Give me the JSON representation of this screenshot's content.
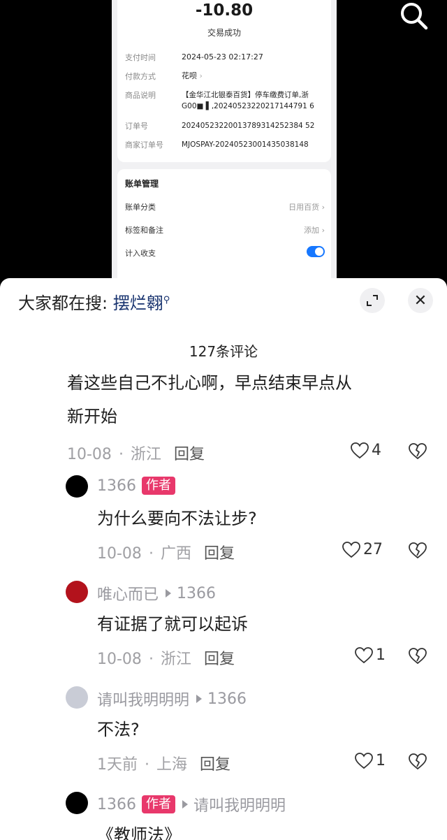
{
  "receipt": {
    "amount": "-10.80",
    "status": "交易成功",
    "rows": [
      {
        "key": "支付时间",
        "value": "2024-05-23 02:17:27"
      },
      {
        "key": "付款方式",
        "value": "花呗"
      },
      {
        "key": "商品说明",
        "value": "【金华江北银泰百货】停车缴费订单,浙G00■ ▌,20240523220217144791 6"
      },
      {
        "key": "订单号",
        "value": "20240523220013789314252384 52"
      },
      {
        "key": "商家订单号",
        "value": "MJOSPAY-20240523001435038148"
      }
    ],
    "management": {
      "title": "账单管理",
      "rows": [
        {
          "label": "账单分类",
          "value": "日用百货"
        },
        {
          "label": "标签和备注",
          "value": "添加"
        },
        {
          "label": "计入收支",
          "value": ""
        }
      ]
    }
  },
  "header": {
    "hot_search_prefix": "大家都在搜:",
    "hot_search_keyword": "摆烂翱"
  },
  "comment_count": "127条评论",
  "comments": [
    {
      "text_line1": "着这些自己不扎心啊，早点结束早点从",
      "text_line2": "新开始",
      "date": "10-08",
      "location": "浙江",
      "reply": "回复",
      "likes": "4"
    },
    {
      "user": "1366",
      "author_tag": "作者",
      "text": "为什么要向不法让步?",
      "date": "10-08",
      "location": "广西",
      "reply": "回复",
      "likes": "27"
    },
    {
      "user": "唯心而已",
      "reply_to": "1366",
      "text": "有证据了就可以起诉",
      "date": "10-08",
      "location": "浙江",
      "reply": "回复",
      "likes": "1"
    },
    {
      "user": "请叫我明明明",
      "reply_to": "1366",
      "text": "不法?",
      "date": "1天前",
      "location": "上海",
      "reply": "回复",
      "likes": "1"
    },
    {
      "user": "1366",
      "author_tag": "作者",
      "reply_to": "请叫我明明明",
      "text": "《教师法》"
    }
  ],
  "colors": {
    "accent_blue": "#1677ff",
    "author_tag": "#e8386b",
    "keyword": "#18336f"
  }
}
